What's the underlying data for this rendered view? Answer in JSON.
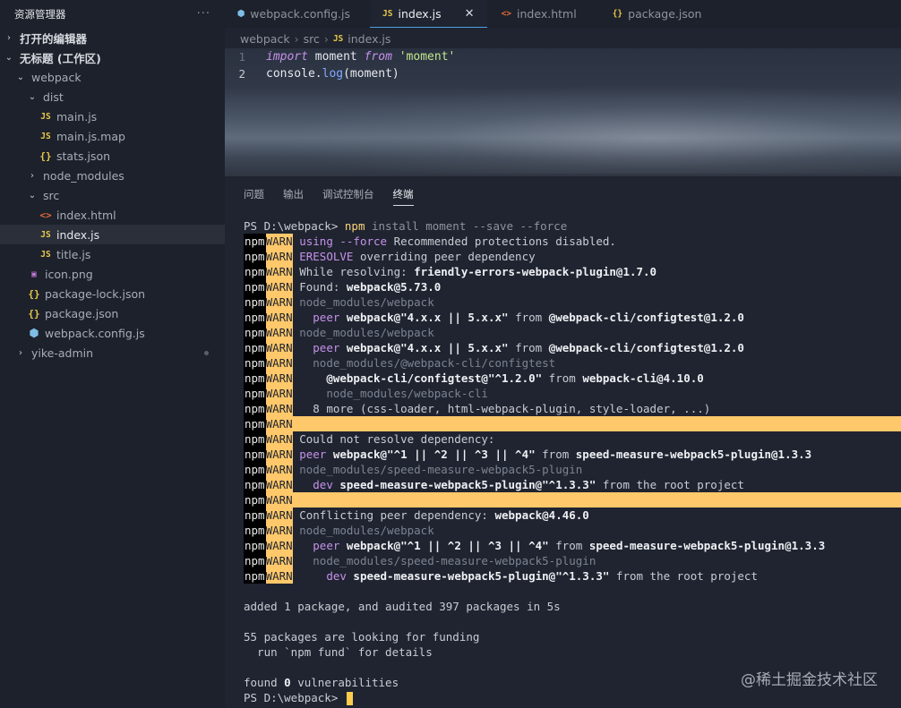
{
  "sidebar": {
    "title": "资源管理器",
    "more": "···",
    "items": [
      {
        "label": "打开的编辑器",
        "chev": "›",
        "indent": 0,
        "icon": "",
        "bold": true
      },
      {
        "label": "无标题 (工作区)",
        "chev": "⌄",
        "indent": 0,
        "icon": "",
        "bold": true
      },
      {
        "label": "webpack",
        "chev": "⌄",
        "indent": 1,
        "icon": ""
      },
      {
        "label": "dist",
        "chev": "⌄",
        "indent": 2,
        "icon": ""
      },
      {
        "label": "main.js",
        "chev": "",
        "indent": 3,
        "icon": "JS",
        "kind": "js"
      },
      {
        "label": "main.js.map",
        "chev": "",
        "indent": 3,
        "icon": "JS",
        "kind": "js"
      },
      {
        "label": "stats.json",
        "chev": "",
        "indent": 3,
        "icon": "{}",
        "kind": "json"
      },
      {
        "label": "node_modules",
        "chev": "›",
        "indent": 2,
        "icon": ""
      },
      {
        "label": "src",
        "chev": "⌄",
        "indent": 2,
        "icon": ""
      },
      {
        "label": "index.html",
        "chev": "",
        "indent": 3,
        "icon": "<>",
        "kind": "html"
      },
      {
        "label": "index.js",
        "chev": "",
        "indent": 3,
        "icon": "JS",
        "kind": "js",
        "selected": true
      },
      {
        "label": "title.js",
        "chev": "",
        "indent": 3,
        "icon": "JS",
        "kind": "js"
      },
      {
        "label": "icon.png",
        "chev": "",
        "indent": 2,
        "icon": "▣",
        "kind": "png"
      },
      {
        "label": "package-lock.json",
        "chev": "",
        "indent": 2,
        "icon": "{}",
        "kind": "json"
      },
      {
        "label": "package.json",
        "chev": "",
        "indent": 2,
        "icon": "{}",
        "kind": "json"
      },
      {
        "label": "webpack.config.js",
        "chev": "",
        "indent": 2,
        "icon": "⬢",
        "kind": "wp"
      },
      {
        "label": "yike-admin",
        "chev": "›",
        "indent": 1,
        "icon": "",
        "badge": true
      }
    ]
  },
  "tabs": [
    {
      "label": "webpack.config.js",
      "icon": "⬢",
      "kind": "wp"
    },
    {
      "label": "index.js",
      "icon": "JS",
      "kind": "js",
      "active": true,
      "close": "✕"
    },
    {
      "label": "index.html",
      "icon": "<>",
      "kind": "html"
    },
    {
      "label": "package.json",
      "icon": "{}",
      "kind": "json"
    }
  ],
  "breadcrumb": {
    "parts": [
      "webpack",
      "src"
    ],
    "file": "index.js",
    "file_icon": "JS"
  },
  "editor": {
    "lines": [
      {
        "n": "1",
        "tokens": [
          [
            "kw",
            "import"
          ],
          [
            "id",
            " moment "
          ],
          [
            "kw",
            "from"
          ],
          [
            "str",
            " 'moment'"
          ]
        ]
      },
      {
        "n": "2",
        "tokens": [
          [
            "id",
            "console"
          ],
          [
            "id",
            "."
          ],
          [
            "fn",
            "log"
          ],
          [
            "id",
            "(moment)"
          ]
        ]
      }
    ]
  },
  "panel": {
    "tabs": [
      "问题",
      "输出",
      "调试控制台",
      "终端"
    ],
    "active_tab": "终端"
  },
  "terminal": {
    "prompt_line": {
      "prompt": "PS D:\\webpack> ",
      "cmd": "npm",
      "args": " install moment --save --force"
    },
    "npm": "npm",
    "warn": "WARN",
    "warn_lines": [
      [
        [
          "prp",
          "using --force"
        ],
        [
          "t",
          " Recommended protections disabled."
        ]
      ],
      [
        [
          "prp",
          "ERESOLVE"
        ],
        [
          "t",
          " overriding peer dependency"
        ]
      ],
      [
        [
          "t",
          "While resolving: "
        ],
        [
          "b",
          "friendly-errors-webpack-plugin@1.7.0"
        ]
      ],
      [
        [
          "t",
          "Found: "
        ],
        [
          "b",
          "webpack@5.73.0"
        ]
      ],
      [
        [
          "dim",
          "node_modules/webpack"
        ]
      ],
      [
        [
          "t",
          "  "
        ],
        [
          "prp",
          "peer"
        ],
        [
          "b",
          " webpack@\"4.x.x || 5.x.x\""
        ],
        [
          "t",
          " from "
        ],
        [
          "b",
          "@webpack-cli/configtest@1.2.0"
        ]
      ],
      [
        [
          "dim",
          "node_modules/webpack"
        ]
      ],
      [
        [
          "t",
          "  "
        ],
        [
          "prp",
          "peer"
        ],
        [
          "b",
          " webpack@\"4.x.x || 5.x.x\""
        ],
        [
          "t",
          " from "
        ],
        [
          "b",
          "@webpack-cli/configtest@1.2.0"
        ]
      ],
      [
        [
          "dim",
          "  node_modules/@webpack-cli/configtest"
        ]
      ],
      [
        [
          "t",
          "    "
        ],
        [
          "b",
          "@webpack-cli/configtest@\"^1.2.0\""
        ],
        [
          "t",
          " from "
        ],
        [
          "b",
          "webpack-cli@4.10.0"
        ]
      ],
      [
        [
          "dim",
          "    node_modules/webpack-cli"
        ]
      ],
      [
        [
          "t",
          "  8 more (css-loader, html-webpack-plugin, style-loader, ...)"
        ]
      ],
      {
        "hl": true
      },
      [
        [
          "t",
          "Could not resolve dependency:"
        ]
      ],
      [
        [
          "prp",
          "peer"
        ],
        [
          "b",
          " webpack@\"^1 || ^2 || ^3 || ^4\""
        ],
        [
          "t",
          " from "
        ],
        [
          "b",
          "speed-measure-webpack5-plugin@1.3.3"
        ]
      ],
      [
        [
          "dim",
          "node_modules/speed-measure-webpack5-plugin"
        ]
      ],
      [
        [
          "t",
          "  "
        ],
        [
          "prp",
          "dev"
        ],
        [
          "b",
          " speed-measure-webpack5-plugin@\"^1.3.3\""
        ],
        [
          "t",
          " from the root project"
        ]
      ],
      {
        "hl": true
      },
      [
        [
          "t",
          "Conflicting peer dependency: "
        ],
        [
          "b",
          "webpack@4.46.0"
        ]
      ],
      [
        [
          "dim",
          "node_modules/webpack"
        ]
      ],
      [
        [
          "t",
          "  "
        ],
        [
          "prp",
          "peer"
        ],
        [
          "b",
          " webpack@\"^1 || ^2 || ^3 || ^4\""
        ],
        [
          "t",
          " from "
        ],
        [
          "b",
          "speed-measure-webpack5-plugin@1.3.3"
        ]
      ],
      [
        [
          "dim",
          "  node_modules/speed-measure-webpack5-plugin"
        ]
      ],
      [
        [
          "t",
          "    "
        ],
        [
          "prp",
          "dev"
        ],
        [
          "b",
          " speed-measure-webpack5-plugin@\"^1.3.3\""
        ],
        [
          "t",
          " from the root project"
        ]
      ]
    ],
    "tail": [
      "",
      "added 1 package, and audited 397 packages in 5s",
      "",
      "55 packages are looking for funding",
      "  run `npm fund` for details",
      ""
    ],
    "vuln": {
      "pre": "found ",
      "count": "0",
      "post": " vulnerabilities"
    },
    "final_prompt": "PS D:\\webpack> "
  },
  "watermark": "@稀土掘金技术社区"
}
